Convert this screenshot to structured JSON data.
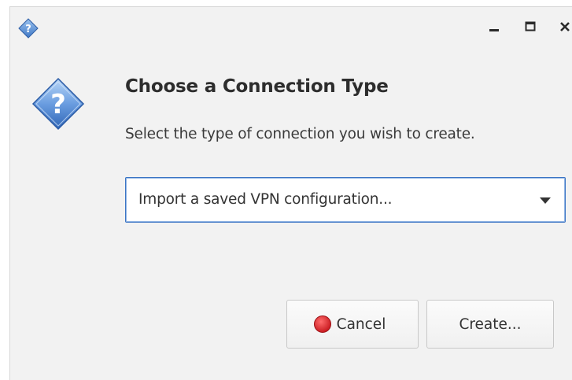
{
  "window": {
    "titlebar_icon": "help-icon",
    "controls": {
      "minimize": "minimize-icon",
      "maximize": "maximize-icon",
      "close": "close-icon"
    }
  },
  "dialog": {
    "icon": "question-icon",
    "heading": "Choose a Connection Type",
    "description": "Select the type of connection you wish to create.",
    "connection_type": {
      "selected": "Import a saved VPN configuration..."
    },
    "buttons": {
      "cancel_label": "Cancel",
      "cancel_icon": "stop-icon",
      "create_label": "Create..."
    }
  },
  "colors": {
    "accent": "#3b74c4",
    "cancel_icon": "#d81e1e",
    "background": "#f2f2f2"
  }
}
